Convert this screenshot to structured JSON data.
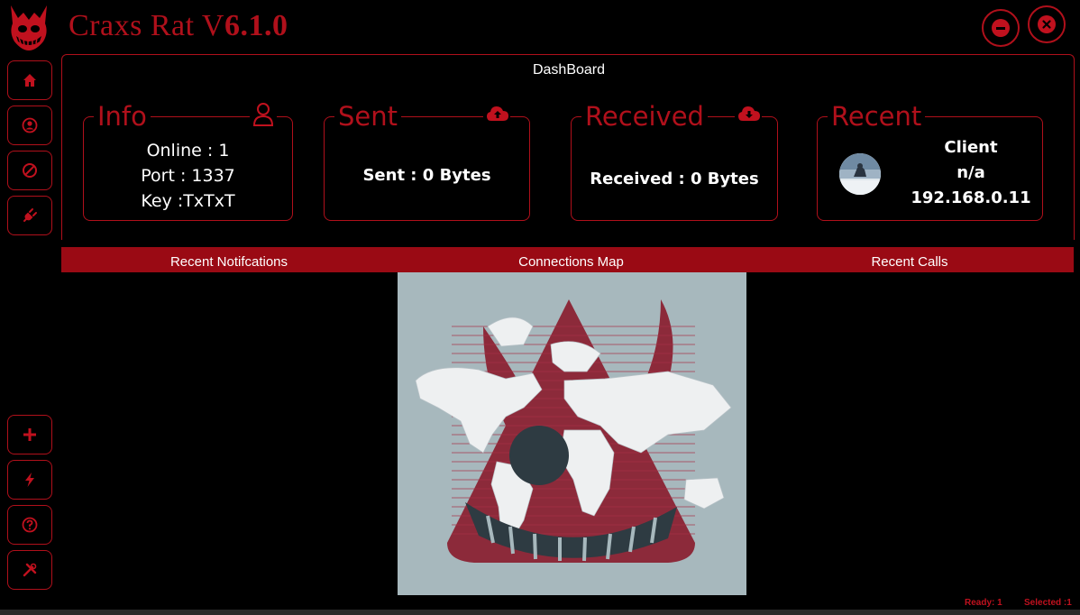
{
  "window": {
    "title_main": "Craxs Rat V",
    "title_version": "6.1.0"
  },
  "dashboard": {
    "title": "DashBoard",
    "info": {
      "title": "Info",
      "online": "Online : 1",
      "port": "Port : 1337",
      "key": "Key :TxTxT"
    },
    "sent": {
      "title": "Sent",
      "value": "Sent : 0 Bytes"
    },
    "received": {
      "title": "Received",
      "value": "Received : 0 Bytes"
    },
    "recent": {
      "title": "Recent",
      "client_label": "Client",
      "client_name": "n/a",
      "client_ip": "192.168.0.11"
    }
  },
  "tabs": {
    "notifications": "Recent Notifcations",
    "map": "Connections Map",
    "calls": "Recent Calls"
  },
  "status": {
    "ready": "Ready: 1",
    "selected": "Selected :1"
  },
  "sidebar": {
    "top_icons": [
      "home-icon",
      "user-icon",
      "block-icon",
      "plug-icon"
    ],
    "bottom_icons": [
      "plus-icon",
      "bolt-icon",
      "help-icon",
      "tools-icon"
    ]
  },
  "colors": {
    "accent": "#b0101b",
    "tab_bg": "#9a0a14",
    "background": "#000000",
    "map_bg": "#a7b8bd"
  }
}
